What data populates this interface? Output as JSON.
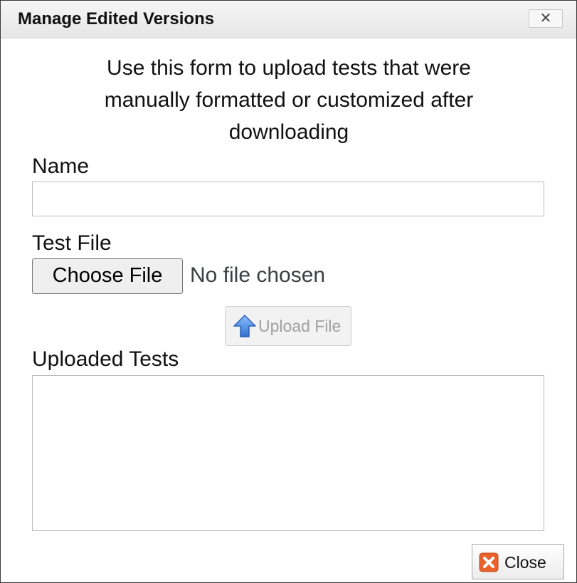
{
  "dialog": {
    "title": "Manage Edited Versions",
    "title_close_symbol": "✕",
    "intro_lines": [
      "Use this form to upload tests that were",
      "manually formatted or customized after",
      "downloading"
    ]
  },
  "form": {
    "name_label": "Name",
    "name_value": "",
    "test_file_label": "Test File",
    "choose_file_label": "Choose File",
    "file_status": "No file chosen",
    "upload_button_label": "Upload File",
    "upload_icon": "arrow-up-icon",
    "uploaded_tests_label": "Uploaded Tests",
    "uploaded_tests": []
  },
  "footer": {
    "close_button_label": "Close",
    "close_icon": "close-x-icon"
  },
  "colors": {
    "upload_arrow": "#3f7fd8",
    "close_icon_bg": "#e8622a",
    "disabled_text": "#a0a0a0"
  }
}
